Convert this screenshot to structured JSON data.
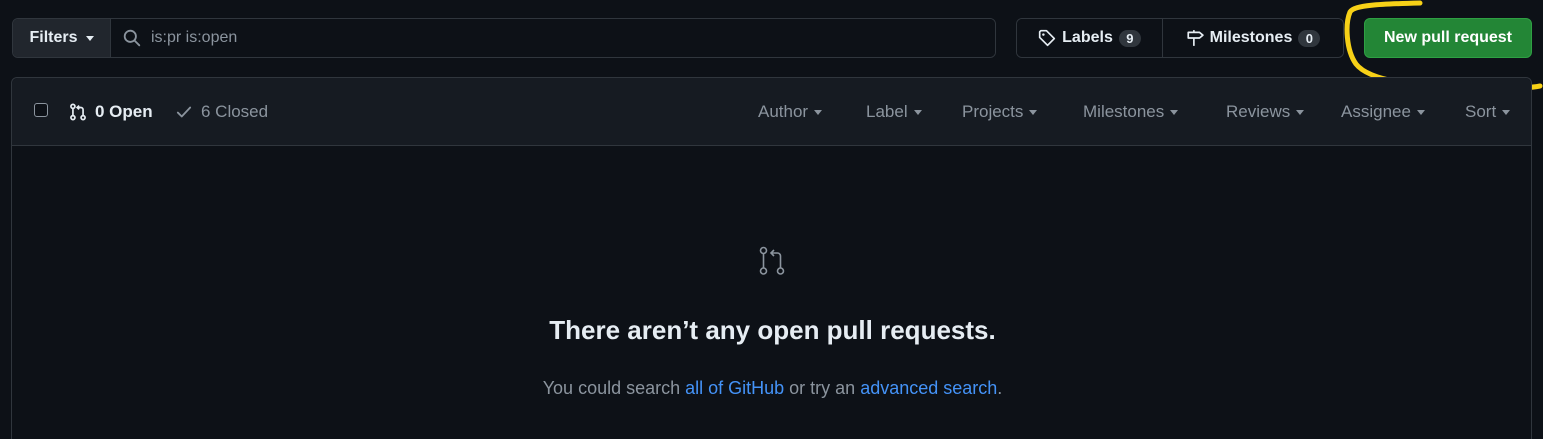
{
  "filters": {
    "label": "Filters",
    "search_value": "is:pr is:open"
  },
  "labels": {
    "label": "Labels",
    "count": "9"
  },
  "milestones": {
    "label": "Milestones",
    "count": "0"
  },
  "new_pr": {
    "label": "New pull request"
  },
  "states": {
    "open": "0 Open",
    "closed": "6 Closed"
  },
  "facets": {
    "author": "Author",
    "label": "Label",
    "projects": "Projects",
    "milestones": "Milestones",
    "reviews": "Reviews",
    "assignee": "Assignee",
    "sort": "Sort"
  },
  "empty": {
    "title": "There aren’t any open pull requests.",
    "prefix": "You could search ",
    "link1": "all of GitHub",
    "middle": " or try an ",
    "link2": "advanced search",
    "suffix": "."
  },
  "colors": {
    "background": "#0d1117",
    "header_bg": "#161b22",
    "border": "#30363d",
    "primary_button": "#238636",
    "link": "#4493f8",
    "highlight_annotation": "#f7d117"
  }
}
